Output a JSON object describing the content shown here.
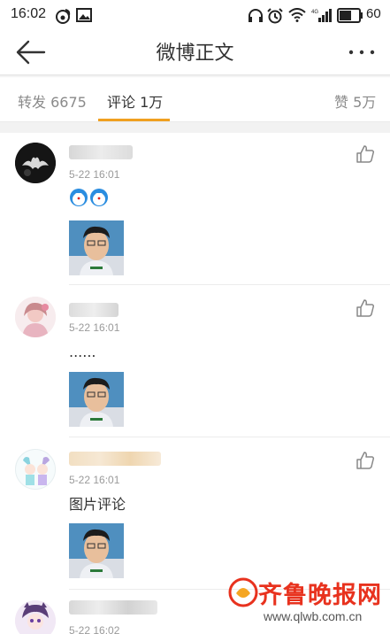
{
  "status_bar": {
    "time": "16:02",
    "battery": "60",
    "icons": [
      "weibo-icon",
      "image-icon",
      "headphones-icon",
      "alarm-icon",
      "wifi-icon",
      "signal-4g-icon",
      "battery-icon"
    ]
  },
  "nav": {
    "title": "微博正文",
    "back_icon": "arrow-left-icon",
    "more_icon": "more-horizontal-icon"
  },
  "tabs": {
    "repost": "转发 6675",
    "comments": "评论 1万",
    "likes": "赞 5万",
    "active": "comments",
    "accent_color": "#f0a020"
  },
  "comments": [
    {
      "time": "5-22 16:01",
      "text": "",
      "emoji": [
        "doraemon-emoji",
        "doraemon-emoji"
      ],
      "has_image": true
    },
    {
      "time": "5-22 16:01",
      "text": "......",
      "has_image": true
    },
    {
      "time": "5-22 16:01",
      "text": "图片评论",
      "has_image": true
    },
    {
      "time": "5-22 16:02",
      "text": "",
      "has_image": false
    }
  ],
  "watermark": {
    "name": "齐鲁晚报网",
    "url": "www.qlwb.com.cn"
  }
}
